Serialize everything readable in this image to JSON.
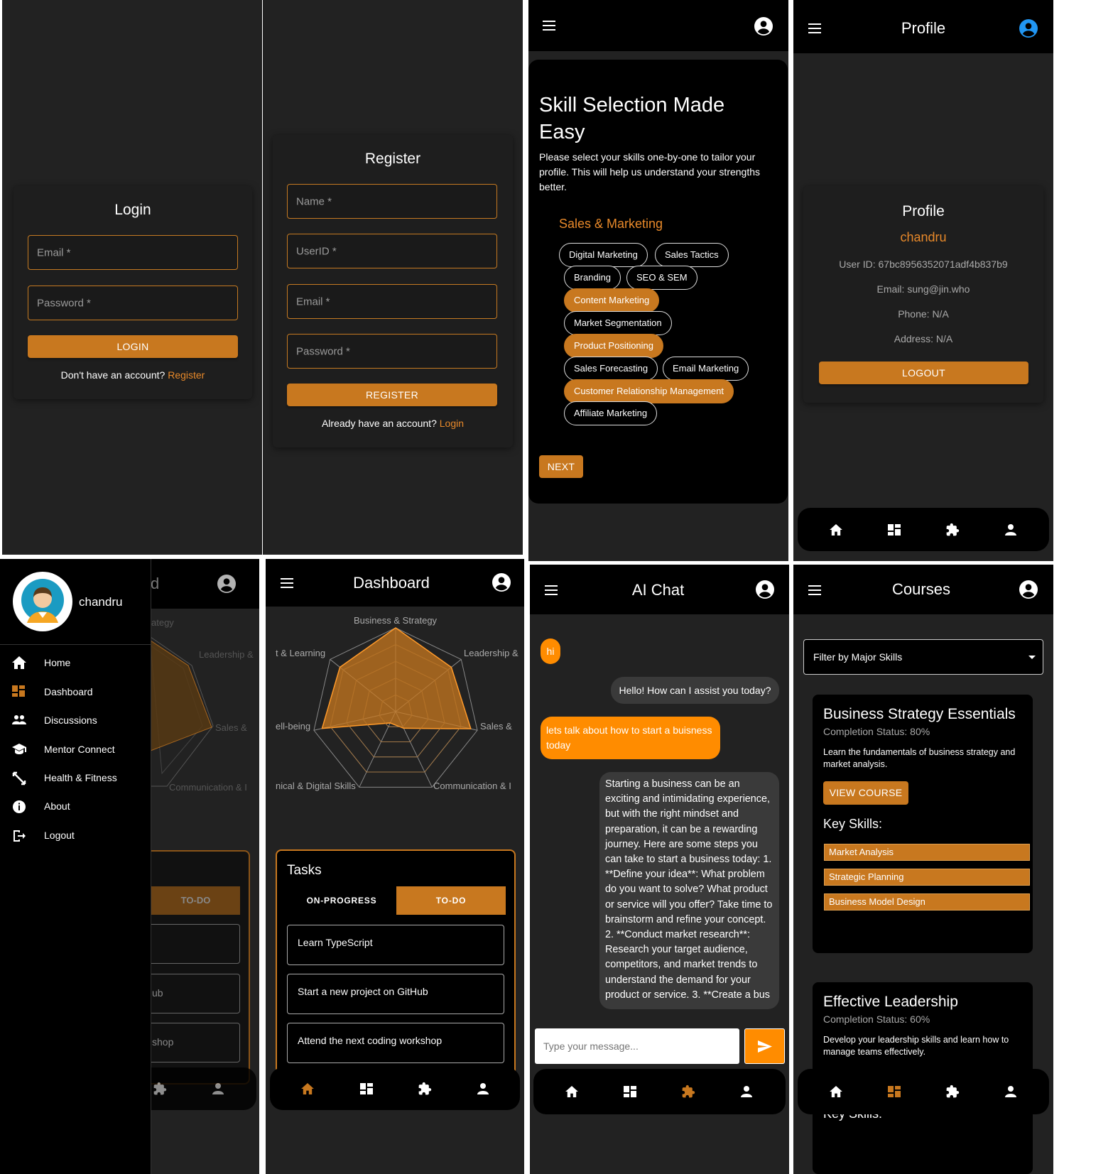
{
  "login": {
    "title": "Login",
    "email_label": "Email *",
    "password_label": "Password *",
    "button": "LOGIN",
    "footer_text": "Don't have an account?",
    "footer_link": "Register"
  },
  "register": {
    "title": "Register",
    "name_label": "Name *",
    "userid_label": "UserID *",
    "email_label": "Email *",
    "password_label": "Password *",
    "button": "REGISTER",
    "footer_text": "Already have an account?",
    "footer_link": "Login"
  },
  "skills": {
    "title_line1": "Skill Selection Made",
    "title_line2": "Easy",
    "description": "Please select your skills one-by-one to tailor your profile. This will help us understand your strengths better.",
    "category": "Sales & Marketing",
    "chips": [
      {
        "label": "Digital Marketing",
        "selected": false
      },
      {
        "label": "Sales Tactics",
        "selected": false
      },
      {
        "label": "Branding",
        "selected": false
      },
      {
        "label": "SEO & SEM",
        "selected": false
      },
      {
        "label": "Content Marketing",
        "selected": true
      },
      {
        "label": "Market Segmentation",
        "selected": false
      },
      {
        "label": "Product Positioning",
        "selected": true
      },
      {
        "label": "Sales Forecasting",
        "selected": false
      },
      {
        "label": "Email Marketing",
        "selected": false
      },
      {
        "label": "Customer Relationship Management",
        "selected": true
      },
      {
        "label": "Affiliate Marketing",
        "selected": false
      }
    ],
    "next_button": "NEXT"
  },
  "profile": {
    "appbar_title": "Profile",
    "card_title": "Profile",
    "username": "chandru",
    "user_id": "User ID: 67bc8956352071adf4b837b9",
    "email": "Email: sung@jin.who",
    "phone": "Phone: N/A",
    "address": "Address: N/A",
    "logout_button": "LOGOUT"
  },
  "drawer": {
    "username": "chandru",
    "items": [
      {
        "label": "Home",
        "icon": "home-icon"
      },
      {
        "label": "Dashboard",
        "icon": "dashboard-icon"
      },
      {
        "label": "Discussions",
        "icon": "people-icon"
      },
      {
        "label": "Mentor Connect",
        "icon": "school-icon"
      },
      {
        "label": "Health & Fitness",
        "icon": "fitness-icon"
      },
      {
        "label": "About",
        "icon": "info-icon"
      },
      {
        "label": "Logout",
        "icon": "logout-icon"
      }
    ],
    "bg_title_fragment": "d",
    "bg_labels": [
      "ategy",
      "Leadership &",
      "Sales &",
      "Communication & I"
    ],
    "bg_tab": "TO-DO",
    "bg_tasks": [
      "ub",
      "shop"
    ]
  },
  "dashboard": {
    "appbar_title": "Dashboard",
    "radar_labels": [
      "Business & Strategy",
      "Leadership &",
      "Sales &",
      "Communication & I",
      "nical & Digital Skills",
      "ell-being",
      "t & Learning"
    ],
    "tasks_title": "Tasks",
    "tab_progress": "ON-PROGRESS",
    "tab_todo": "TO-DO",
    "tasks": [
      "Learn TypeScript",
      "Start a new project on GitHub",
      "Attend the next coding workshop"
    ]
  },
  "chat": {
    "appbar_title": "AI Chat",
    "messages": [
      {
        "from": "user",
        "text": "hi"
      },
      {
        "from": "bot",
        "text": "Hello! How can I assist you today?"
      },
      {
        "from": "user",
        "text": "lets talk about how to start a buisness today"
      },
      {
        "from": "bot",
        "text": "Starting a business can be an exciting and intimidating experience, but with the right mindset and preparation, it can be a rewarding journey. Here are some steps you can take to start a business today: 1. **Define your idea**: What problem do you want to solve? What product or service will you offer? Take time to brainstorm and refine your concept. 2. **Conduct market research**: Research your target audience, competitors, and market trends to understand the demand for your product or service. 3. **Create a bus"
      }
    ],
    "input_placeholder": "Type your message..."
  },
  "courses": {
    "appbar_title": "Courses",
    "filter_label": "Filter by Major Skills",
    "items": [
      {
        "title": "Business Strategy Essentials",
        "status": "Completion Status: 80%",
        "description": "Learn the fundamentals of business strategy and market analysis.",
        "button": "VIEW COURSE",
        "key_skills_label": "Key Skills:",
        "skills": [
          "Market Analysis",
          "Strategic Planning",
          "Business Model Design"
        ]
      },
      {
        "title": "Effective Leadership",
        "status": "Completion Status: 60%",
        "description": "Develop your leadership skills and learn how to manage teams effectively.",
        "key_skills_label": "Key Skills:"
      }
    ]
  },
  "colors": {
    "accent": "#c8781f",
    "chat_user_bubble": "#ff8c00",
    "chat_bot_bubble": "#3a3a3a",
    "profile_icon": "#2196f3"
  }
}
